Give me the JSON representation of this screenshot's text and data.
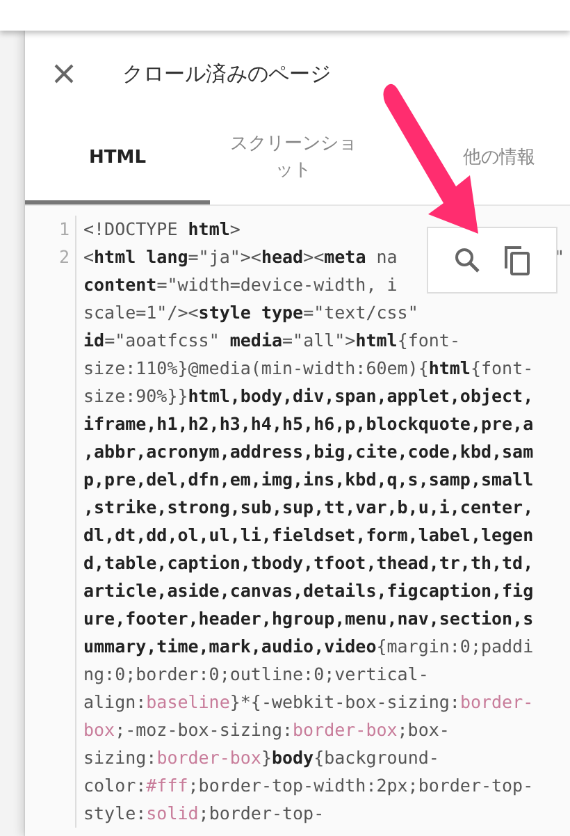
{
  "panel": {
    "title": "クロール済みのページ"
  },
  "tabs": [
    {
      "label": "HTML",
      "selected": true
    },
    {
      "label": "スクリーンショット",
      "selected": false
    },
    {
      "label": "他の情報",
      "selected": false
    }
  ],
  "code_rows": [
    {
      "number": "1",
      "segments": [
        {
          "kind": "plain",
          "text": "<!DOCTYPE "
        },
        {
          "kind": "tag",
          "text": "html"
        },
        {
          "kind": "plain",
          "text": ">"
        }
      ]
    },
    {
      "number": "2",
      "segments": [
        {
          "kind": "plain",
          "text": "<"
        },
        {
          "kind": "tag",
          "text": "html lang"
        },
        {
          "kind": "plain",
          "text": "=\"ja\"><"
        },
        {
          "kind": "tag",
          "text": "head"
        },
        {
          "kind": "plain",
          "text": "><"
        },
        {
          "kind": "tag",
          "text": "meta"
        },
        {
          "kind": "plain",
          "text": " na"
        }
      ],
      "right": "\""
    },
    {
      "segments": [
        {
          "kind": "tag",
          "text": "content"
        },
        {
          "kind": "plain",
          "text": "=\"width=device-width, i"
        }
      ]
    },
    {
      "segments": [
        {
          "kind": "plain",
          "text": "scale=1\"/><"
        },
        {
          "kind": "tag",
          "text": "style type"
        },
        {
          "kind": "plain",
          "text": "=\"text/css\""
        }
      ]
    },
    {
      "segments": [
        {
          "kind": "tag",
          "text": "id"
        },
        {
          "kind": "plain",
          "text": "=\"aoatfcss\" "
        },
        {
          "kind": "tag",
          "text": "media"
        },
        {
          "kind": "plain",
          "text": "=\"all\">"
        },
        {
          "kind": "tag",
          "text": "html"
        },
        {
          "kind": "plain",
          "text": "{font-"
        }
      ]
    },
    {
      "segments": [
        {
          "kind": "plain",
          "text": "size:110%}@media(min-width:60em){"
        },
        {
          "kind": "tag",
          "text": "html"
        },
        {
          "kind": "plain",
          "text": "{font-"
        }
      ]
    },
    {
      "segments": [
        {
          "kind": "plain",
          "text": "size:90%}}"
        },
        {
          "kind": "tag",
          "text": "html,body,div,span,applet,object,"
        }
      ]
    },
    {
      "segments": [
        {
          "kind": "tag",
          "text": "iframe,h1,h2,h3,h4,h5,h6,p,blockquote,pre,a"
        }
      ]
    },
    {
      "segments": [
        {
          "kind": "tag",
          "text": ",abbr,acronym,address,big,cite,code,kbd,sam"
        }
      ]
    },
    {
      "segments": [
        {
          "kind": "tag",
          "text": "p,pre,del,dfn,em,img,ins,kbd,q,s,samp,small"
        }
      ]
    },
    {
      "segments": [
        {
          "kind": "tag",
          "text": ",strike,strong,sub,sup,tt,var,b,u,i,center,"
        }
      ]
    },
    {
      "segments": [
        {
          "kind": "tag",
          "text": "dl,dt,dd,ol,ul,li,fieldset,form,label,legen"
        }
      ]
    },
    {
      "segments": [
        {
          "kind": "tag",
          "text": "d,table,caption,tbody,tfoot,thead,tr,th,td,"
        }
      ]
    },
    {
      "segments": [
        {
          "kind": "tag",
          "text": "article,aside,canvas,details,figcaption,fig"
        }
      ]
    },
    {
      "segments": [
        {
          "kind": "tag",
          "text": "ure,footer,header,hgroup,menu,nav,section,s"
        }
      ]
    },
    {
      "segments": [
        {
          "kind": "tag",
          "text": "ummary,time,mark,audio,video"
        },
        {
          "kind": "plain",
          "text": "{margin:0;paddi"
        }
      ]
    },
    {
      "segments": [
        {
          "kind": "plain",
          "text": "ng:0;border:0;outline:0;vertical-"
        }
      ]
    },
    {
      "segments": [
        {
          "kind": "plain",
          "text": "align:"
        },
        {
          "kind": "value",
          "text": "baseline"
        },
        {
          "kind": "plain",
          "text": "}*{-webkit-box-sizing:"
        },
        {
          "kind": "value",
          "text": "border-"
        }
      ]
    },
    {
      "segments": [
        {
          "kind": "value",
          "text": "box"
        },
        {
          "kind": "plain",
          "text": ";-moz-box-sizing:"
        },
        {
          "kind": "value",
          "text": "border-box"
        },
        {
          "kind": "plain",
          "text": ";box-"
        }
      ]
    },
    {
      "segments": [
        {
          "kind": "plain",
          "text": "sizing:"
        },
        {
          "kind": "value",
          "text": "border-box"
        },
        {
          "kind": "plain",
          "text": "}"
        },
        {
          "kind": "tag",
          "text": "body"
        },
        {
          "kind": "plain",
          "text": "{background-"
        }
      ]
    },
    {
      "segments": [
        {
          "kind": "plain",
          "text": "color:"
        },
        {
          "kind": "value",
          "text": "#fff"
        },
        {
          "kind": "plain",
          "text": ";border-top-width:2px;border-top-"
        }
      ]
    },
    {
      "segments": [
        {
          "kind": "plain",
          "text": "style:"
        },
        {
          "kind": "value",
          "text": "solid"
        },
        {
          "kind": "plain",
          "text": ";border-top-"
        }
      ]
    }
  ]
}
